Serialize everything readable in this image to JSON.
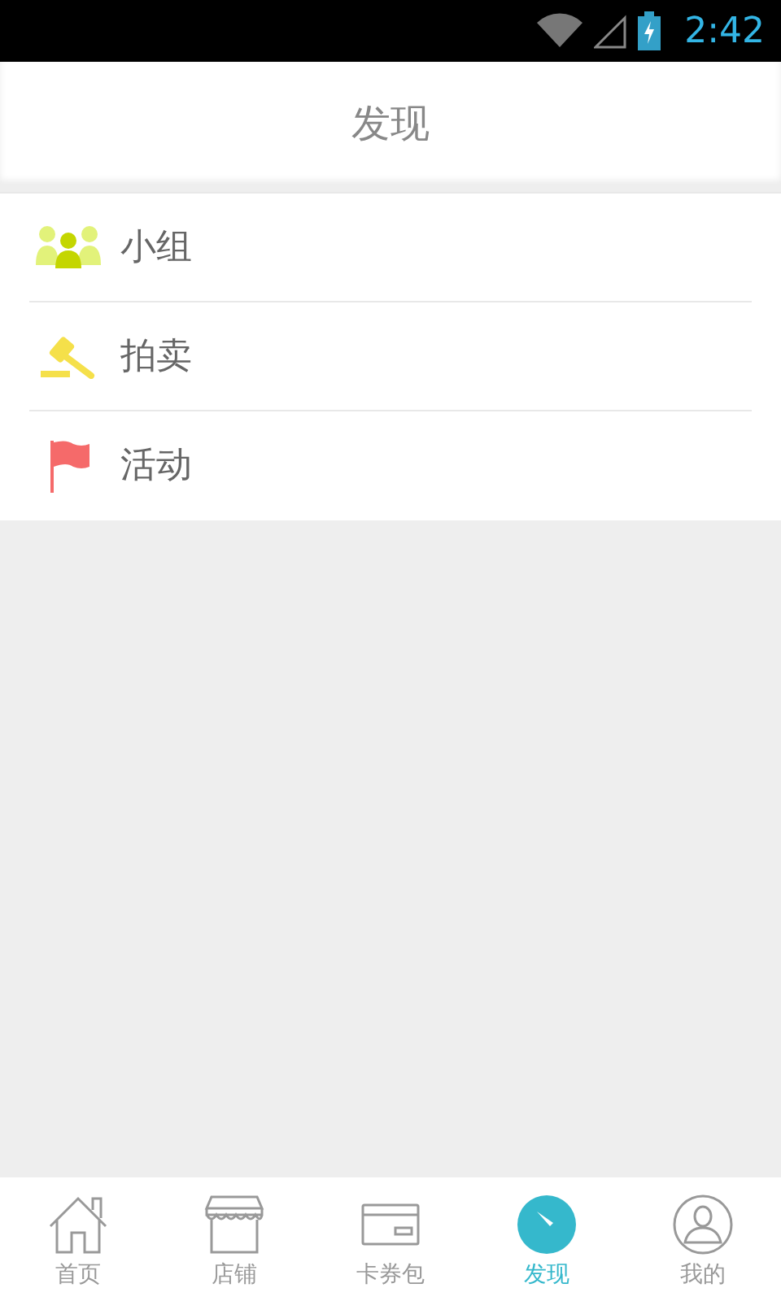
{
  "status_bar": {
    "time": "2:42"
  },
  "header": {
    "title": "发现"
  },
  "items": [
    {
      "kind": "group",
      "label": "小组"
    },
    {
      "kind": "auction",
      "label": "拍卖"
    },
    {
      "kind": "event",
      "label": "活动"
    }
  ],
  "tabs": [
    {
      "kind": "home",
      "label": "首页",
      "selected": false
    },
    {
      "kind": "shop",
      "label": "店铺",
      "selected": false
    },
    {
      "kind": "card",
      "label": "卡券包",
      "selected": false
    },
    {
      "kind": "discover",
      "label": "发现",
      "selected": true
    },
    {
      "kind": "me",
      "label": "我的",
      "selected": false
    }
  ]
}
